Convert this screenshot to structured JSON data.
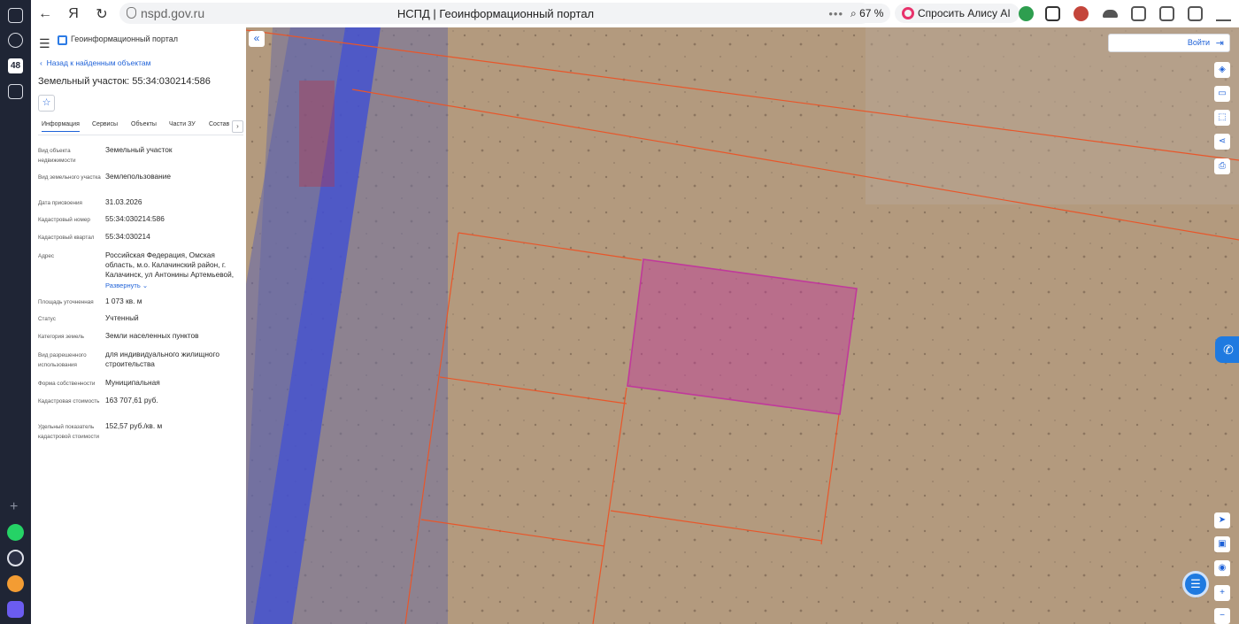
{
  "browser": {
    "url_host": "nspd.gov.ru",
    "page_title": "НСПД | Геоинформационный портал",
    "zoom": "67 %",
    "alice_label": "Спросить Алису AI",
    "rail_badge": "48"
  },
  "panel": {
    "header_title": "Геоинформационный портал",
    "back_link": "Назад к найденным объектам",
    "object_title": "Земельный участок: 55:34:030214:586",
    "tabs": [
      "Информация",
      "Сервисы",
      "Объекты",
      "Части ЗУ",
      "Состав"
    ],
    "active_tab": "Информация",
    "expand_link": "Развернуть",
    "rows": [
      {
        "label": "Вид объекта недвижимости",
        "value": "Земельный участок"
      },
      {
        "label": "Вид земельного участка",
        "value": "Землепользование"
      },
      {
        "label": "Дата присвоения",
        "value": "31.03.2026"
      },
      {
        "label": "Кадастровый номер",
        "value": "55:34:030214:586"
      },
      {
        "label": "Кадастровый квартал",
        "value": "55:34:030214"
      },
      {
        "label": "Адрес",
        "value": "Российская Федерация, Омская область, м.о. Калачинский район, г. Калачинск, ул Антонины Артемьевой,"
      },
      {
        "label": "Площадь уточненная",
        "value": "1 073 кв. м"
      },
      {
        "label": "Статус",
        "value": "Учтенный"
      },
      {
        "label": "Категория земель",
        "value": "Земли населенных пунктов"
      },
      {
        "label": "Вид разрешенного использования",
        "value": "для индивидуального жилищного строительства"
      },
      {
        "label": "Форма собственности",
        "value": "Муниципальная"
      },
      {
        "label": "Кадастровая стоимость",
        "value": "163 707,61 руб."
      },
      {
        "label": "Удельный показатель кадастровой стоимости",
        "value": "152,57 руб./кв. м"
      }
    ]
  },
  "map": {
    "login_label": "Войти",
    "selected_parcel_color": "#c0399b",
    "parcel_border_color": "#e8562a",
    "road_overlay_color": "#3b4bd8"
  }
}
